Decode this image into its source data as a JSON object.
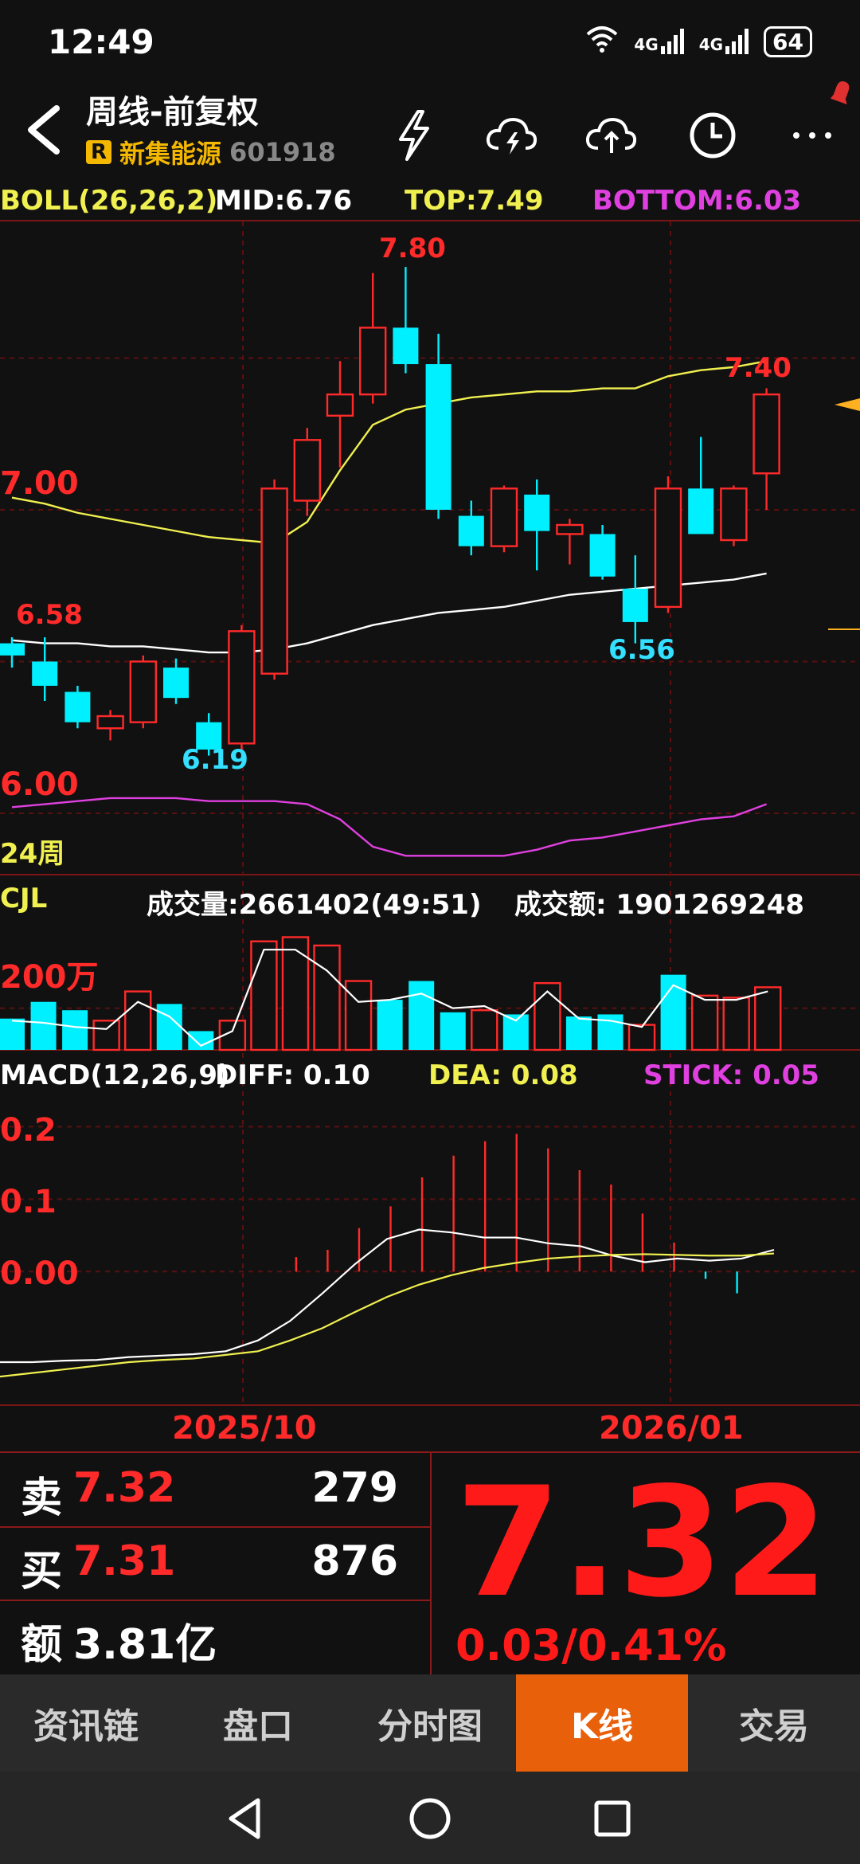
{
  "status_bar": {
    "time": "12:49",
    "signal1": "4G",
    "signal2": "4G",
    "battery": "64"
  },
  "header": {
    "title": "周线-前复权",
    "badge": "R",
    "stock_name": "新集能源",
    "stock_code": "601918",
    "icons": [
      "lightning-icon",
      "cloud-lightning-icon",
      "cloud-upload-icon",
      "clock-icon",
      "more-icon"
    ]
  },
  "boll": {
    "label": "BOLL(26,26,2)",
    "mid": "MID:6.76",
    "top": "TOP:7.49",
    "bottom": "BOTTOM:6.03"
  },
  "price_axis": {
    "p700": "7.00",
    "p600": "6.00"
  },
  "annotations": {
    "high": "7.80",
    "recent_high": "7.40",
    "left_high": "6.58",
    "low1": "6.19",
    "low2": "6.56"
  },
  "period_label": "24周",
  "cjl": {
    "label": "CJL",
    "volume": "成交量:2661402(49:51)",
    "amount": "成交额: 1901269248",
    "axis": "200万"
  },
  "macd": {
    "label": "MACD(12,26,9)",
    "diff": "DIFF: 0.10",
    "dea": "DEA: 0.08",
    "stick": "STICK: 0.05",
    "axis": [
      "0.2",
      "0.1",
      "0.00"
    ]
  },
  "dates": [
    "2025/10",
    "2026/01"
  ],
  "quote": {
    "sell_label": "卖",
    "sell_price": "7.32",
    "sell_vol": "279",
    "buy_label": "买",
    "buy_price": "7.31",
    "buy_vol": "876",
    "amount_label": "额",
    "amount_value": "3.81亿",
    "price": "7.32",
    "change": "0.03/0.41%"
  },
  "tabs": [
    {
      "label": "资讯链",
      "active": false
    },
    {
      "label": "盘口",
      "active": false
    },
    {
      "label": "分时图",
      "active": false
    },
    {
      "label": "K线",
      "active": true
    },
    {
      "label": "交易",
      "active": false
    }
  ],
  "colors": {
    "up": "#ff2a2a",
    "down": "#00f0ff",
    "top_line": "#f0f050",
    "bottom_line": "#e040e0",
    "accent": "#e8600a"
  },
  "chart_data": {
    "type": "candlestick",
    "title": "周线-前复权",
    "ylim": [
      5.95,
      7.95
    ],
    "candles": [
      {
        "o": 6.56,
        "h": 6.58,
        "l": 6.48,
        "c": 6.52
      },
      {
        "o": 6.5,
        "h": 6.58,
        "l": 6.37,
        "c": 6.42
      },
      {
        "o": 6.4,
        "h": 6.42,
        "l": 6.28,
        "c": 6.3
      },
      {
        "o": 6.28,
        "h": 6.34,
        "l": 6.24,
        "c": 6.32
      },
      {
        "o": 6.3,
        "h": 6.52,
        "l": 6.28,
        "c": 6.5
      },
      {
        "o": 6.48,
        "h": 6.51,
        "l": 6.36,
        "c": 6.38
      },
      {
        "o": 6.3,
        "h": 6.33,
        "l": 6.19,
        "c": 6.21
      },
      {
        "o": 6.23,
        "h": 6.62,
        "l": 6.21,
        "c": 6.6
      },
      {
        "o": 6.46,
        "h": 7.1,
        "l": 6.44,
        "c": 7.07
      },
      {
        "o": 7.03,
        "h": 7.27,
        "l": 6.98,
        "c": 7.23
      },
      {
        "o": 7.31,
        "h": 7.49,
        "l": 7.14,
        "c": 7.38
      },
      {
        "o": 7.38,
        "h": 7.78,
        "l": 7.35,
        "c": 7.6
      },
      {
        "o": 7.6,
        "h": 7.8,
        "l": 7.45,
        "c": 7.48
      },
      {
        "o": 7.48,
        "h": 7.58,
        "l": 6.97,
        "c": 7.0
      },
      {
        "o": 6.98,
        "h": 7.03,
        "l": 6.85,
        "c": 6.88
      },
      {
        "o": 6.88,
        "h": 7.08,
        "l": 6.86,
        "c": 7.07
      },
      {
        "o": 7.05,
        "h": 7.1,
        "l": 6.8,
        "c": 6.93
      },
      {
        "o": 6.92,
        "h": 6.97,
        "l": 6.82,
        "c": 6.95
      },
      {
        "o": 6.92,
        "h": 6.95,
        "l": 6.77,
        "c": 6.78
      },
      {
        "o": 6.74,
        "h": 6.85,
        "l": 6.56,
        "c": 6.63
      },
      {
        "o": 6.68,
        "h": 7.11,
        "l": 6.66,
        "c": 7.07
      },
      {
        "o": 7.07,
        "h": 7.24,
        "l": 6.94,
        "c": 6.92
      },
      {
        "o": 6.9,
        "h": 7.08,
        "l": 6.88,
        "c": 7.07
      },
      {
        "o": 7.12,
        "h": 7.4,
        "l": 7.0,
        "c": 7.38
      }
    ],
    "boll_mid": [
      6.57,
      6.56,
      6.56,
      6.55,
      6.55,
      6.54,
      6.53,
      6.53,
      6.54,
      6.56,
      6.59,
      6.62,
      6.64,
      6.66,
      6.67,
      6.68,
      6.7,
      6.72,
      6.73,
      6.74,
      6.75,
      6.76,
      6.77,
      6.79
    ],
    "boll_top": [
      7.04,
      7.02,
      6.99,
      6.97,
      6.95,
      6.93,
      6.91,
      6.9,
      6.89,
      6.96,
      7.13,
      7.28,
      7.33,
      7.35,
      7.37,
      7.38,
      7.39,
      7.39,
      7.4,
      7.4,
      7.44,
      7.46,
      7.47,
      7.49
    ],
    "boll_bottom": [
      6.02,
      6.03,
      6.04,
      6.05,
      6.05,
      6.05,
      6.04,
      6.04,
      6.04,
      6.03,
      5.98,
      5.89,
      5.86,
      5.86,
      5.86,
      5.86,
      5.88,
      5.91,
      5.92,
      5.94,
      5.96,
      5.98,
      5.99,
      6.03
    ],
    "volume": [
      1.5,
      2.3,
      1.9,
      1.4,
      2.8,
      2.2,
      0.9,
      1.4,
      5.2,
      5.4,
      5.0,
      3.3,
      2.4,
      3.3,
      1.8,
      1.9,
      1.7,
      3.2,
      1.6,
      1.7,
      1.2,
      3.6,
      2.6,
      2.5,
      3.0
    ],
    "volume_ma": [
      1.4,
      1.3,
      1.1,
      1.0,
      2.3,
      1.6,
      0.2,
      0.9,
      4.8,
      4.8,
      3.8,
      2.3,
      2.4,
      2.7,
      2.0,
      2.1,
      1.4,
      2.8,
      1.5,
      1.4,
      1.1,
      3.1,
      2.4,
      2.4,
      2.8
    ],
    "macd_diff": [
      -0.125,
      -0.125,
      -0.123,
      -0.122,
      -0.118,
      -0.116,
      -0.114,
      -0.11,
      -0.095,
      -0.068,
      -0.03,
      0.01,
      0.045,
      0.058,
      0.054,
      0.047,
      0.047,
      0.039,
      0.035,
      0.022,
      0.013,
      0.018,
      0.015,
      0.018,
      0.03
    ],
    "macd_dea": [
      -0.145,
      -0.14,
      -0.135,
      -0.13,
      -0.125,
      -0.122,
      -0.12,
      -0.115,
      -0.11,
      -0.095,
      -0.078,
      -0.056,
      -0.035,
      -0.018,
      -0.005,
      0.005,
      0.012,
      0.018,
      0.021,
      0.023,
      0.024,
      0.023,
      0.022,
      0.022,
      0.025
    ],
    "macd_stick": [
      0.0,
      0.0,
      0.0,
      0.0,
      0.0,
      0.0,
      0.0,
      0.02,
      0.03,
      0.06,
      0.09,
      0.13,
      0.16,
      0.18,
      0.19,
      0.17,
      0.14,
      0.12,
      0.08,
      0.04,
      -0.01,
      -0.03,
      0.0,
      -0.02,
      0.05
    ],
    "macd_ylim": [
      -0.18,
      0.24
    ],
    "x_ticks": [
      "2025/10",
      "2026/01"
    ]
  }
}
